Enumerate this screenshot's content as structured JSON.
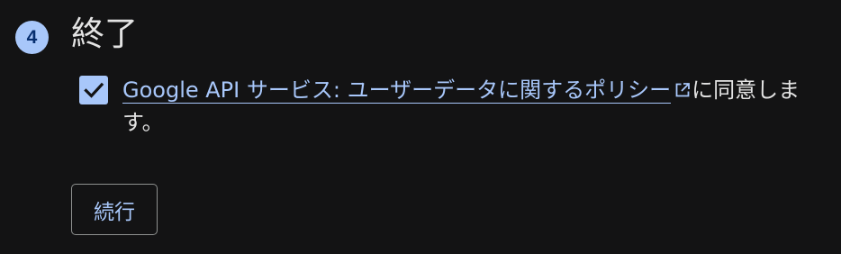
{
  "step": {
    "number": "4",
    "title": "終了"
  },
  "consent": {
    "checked": true,
    "link_text": "Google API サービス: ユーザーデータに関するポリシー",
    "link_icon": "external-link-icon",
    "suffix_text": "に同意します。"
  },
  "actions": {
    "continue_label": "続行"
  },
  "colors": {
    "background": "#131314",
    "accent": "#a8c7fa",
    "text": "#e3e3e3",
    "button_border": "#8e918f"
  }
}
